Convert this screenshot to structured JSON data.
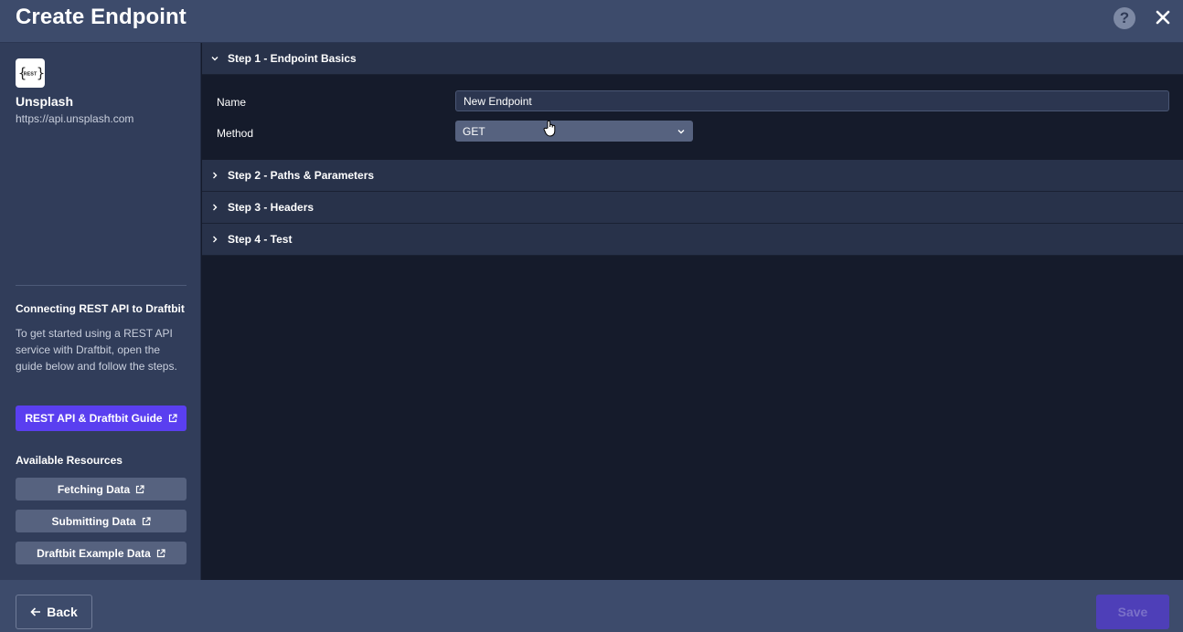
{
  "header": {
    "title": "Create Endpoint",
    "help_icon": "question-mark-icon",
    "help_glyph": "?",
    "close_icon": "close-icon"
  },
  "sidebar": {
    "logo_icon": "rest-logo-icon",
    "logo_text": "REST",
    "api_name": "Unsplash",
    "api_url": "https://api.unsplash.com",
    "guide_title": "Connecting REST API to Draftbit",
    "guide_description": "To get started using a REST API service with Draftbit, open the guide below and follow the steps.",
    "guide_button_label": "REST API & Draftbit Guide",
    "resources_title": "Available Resources",
    "resources": [
      {
        "label": "Fetching Data"
      },
      {
        "label": "Submitting Data"
      },
      {
        "label": "Draftbit Example Data"
      }
    ]
  },
  "steps": [
    {
      "label": "Step 1 - Endpoint Basics",
      "expanded": true
    },
    {
      "label": "Step 2 - Paths & Parameters",
      "expanded": false
    },
    {
      "label": "Step 3 - Headers",
      "expanded": false
    },
    {
      "label": "Step 4 - Test",
      "expanded": false
    }
  ],
  "step1": {
    "name_label": "Name",
    "name_value": "New Endpoint",
    "method_label": "Method",
    "method_value": "GET"
  },
  "footer": {
    "back_label": "Back",
    "save_label": "Save"
  },
  "colors": {
    "header_bg": "#3d4b6b",
    "sidebar_bg": "#313d5a",
    "main_bg": "#151b2b",
    "accent": "#5a3ff0"
  }
}
